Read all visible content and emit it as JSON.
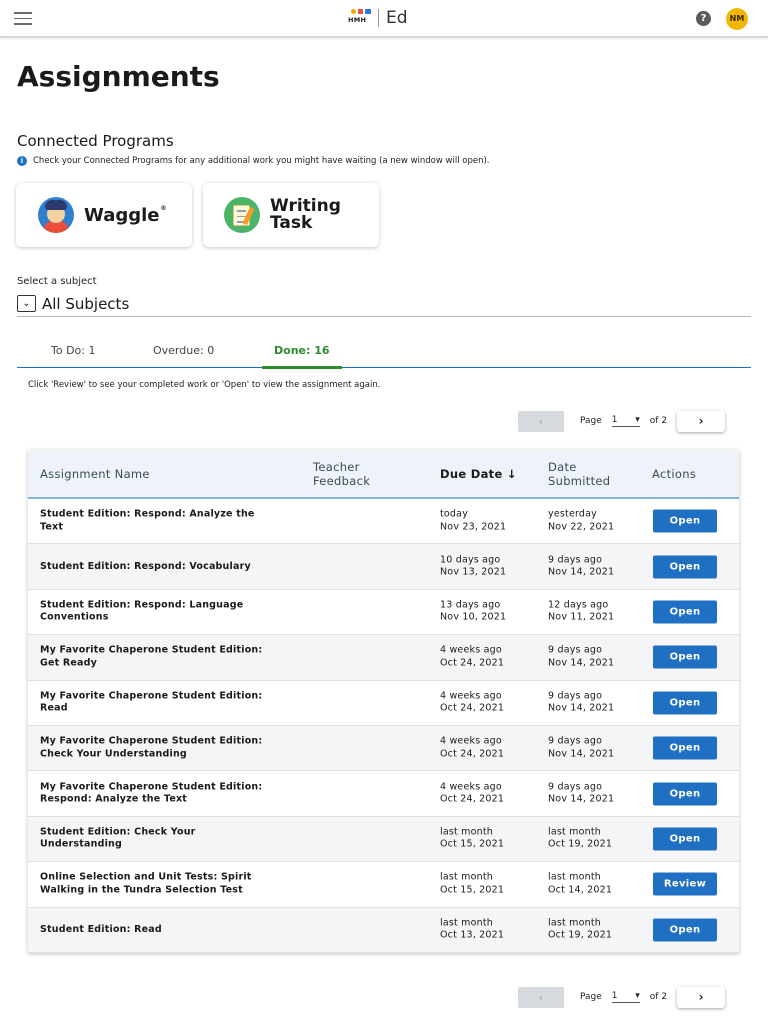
{
  "header": {
    "logo_small": "HMH",
    "logo_product": "Ed",
    "help_glyph": "?",
    "avatar_initials": "NM",
    "colors": {
      "avatar": "#f2b705",
      "accent": "#1f6fc3"
    }
  },
  "page": {
    "title": "Assignments"
  },
  "connected_programs": {
    "title": "Connected Programs",
    "info": "Check your Connected Programs for any additional work you might have waiting (a new window will open).",
    "programs": [
      {
        "name": "Waggle",
        "mark": "®",
        "icon": "waggle-logo-icon"
      },
      {
        "name_line1": "Writing",
        "name_line2": "Task",
        "icon": "writing-task-logo-icon"
      }
    ]
  },
  "subject": {
    "label": "Select a subject",
    "value": "All Subjects"
  },
  "tabs": [
    {
      "label": "To Do: 1",
      "active": false
    },
    {
      "label": "Overdue: 0",
      "active": false
    },
    {
      "label": "Done: 16",
      "active": true,
      "color": "#2e8b2e"
    }
  ],
  "hint": "Click 'Review' to see your completed work or 'Open' to view the assignment again.",
  "pagination": {
    "prev": "‹",
    "next": "›",
    "page_label": "Page",
    "current_page": "1",
    "of_label": "of 2"
  },
  "table": {
    "headers": {
      "name": "Assignment Name",
      "feedback_line1": "Teacher",
      "feedback_line2": "Feedback",
      "due": "Due Date ↓",
      "submitted_line1": "Date",
      "submitted_line2": "Submitted",
      "actions": "Actions"
    },
    "rows": [
      {
        "name_line1": "Student Edition: Respond: Analyze the",
        "name_line2": "Text",
        "due_rel": "today",
        "due_date": "Nov 23, 2021",
        "sub_rel": "yesterday",
        "sub_date": "Nov 22, 2021",
        "action": "Open"
      },
      {
        "name_line1": "Student Edition: Respond: Vocabulary",
        "name_line2": "",
        "due_rel": "10 days ago",
        "due_date": "Nov 13, 2021",
        "sub_rel": "9 days ago",
        "sub_date": "Nov 14, 2021",
        "action": "Open"
      },
      {
        "name_line1": "Student Edition: Respond: Language",
        "name_line2": "Conventions",
        "due_rel": "13 days ago",
        "due_date": "Nov 10, 2021",
        "sub_rel": "12 days ago",
        "sub_date": "Nov 11, 2021",
        "action": "Open"
      },
      {
        "name_line1": "My Favorite Chaperone Student Edition:",
        "name_line2": "Get Ready",
        "due_rel": "4 weeks ago",
        "due_date": "Oct 24, 2021",
        "sub_rel": "9 days ago",
        "sub_date": "Nov 14, 2021",
        "action": "Open"
      },
      {
        "name_line1": "My Favorite Chaperone Student Edition:",
        "name_line2": "Read",
        "due_rel": "4 weeks ago",
        "due_date": "Oct 24, 2021",
        "sub_rel": "9 days ago",
        "sub_date": "Nov 14, 2021",
        "action": "Open"
      },
      {
        "name_line1": "My Favorite Chaperone Student Edition:",
        "name_line2": "Check Your Understanding",
        "due_rel": "4 weeks ago",
        "due_date": "Oct 24, 2021",
        "sub_rel": "9 days ago",
        "sub_date": "Nov 14, 2021",
        "action": "Open"
      },
      {
        "name_line1": "My Favorite Chaperone Student Edition:",
        "name_line2": "Respond: Analyze the Text",
        "due_rel": "4 weeks ago",
        "due_date": "Oct 24, 2021",
        "sub_rel": "9 days ago",
        "sub_date": "Nov 14, 2021",
        "action": "Open"
      },
      {
        "name_line1": "Student Edition: Check Your",
        "name_line2": "Understanding",
        "due_rel": "last month",
        "due_date": "Oct 15, 2021",
        "sub_rel": "last month",
        "sub_date": "Oct 19, 2021",
        "action": "Open"
      },
      {
        "name_line1": "Online Selection and Unit Tests: Spirit",
        "name_line2": "Walking in the Tundra Selection Test",
        "due_rel": "last month",
        "due_date": "Oct 15, 2021",
        "sub_rel": "last month",
        "sub_date": "Oct 14, 2021",
        "action": "Review"
      },
      {
        "name_line1": "Student Edition: Read",
        "name_line2": "",
        "due_rel": "last month",
        "due_date": "Oct 13, 2021",
        "sub_rel": "last month",
        "sub_date": "Oct 19, 2021",
        "action": "Open"
      }
    ]
  }
}
